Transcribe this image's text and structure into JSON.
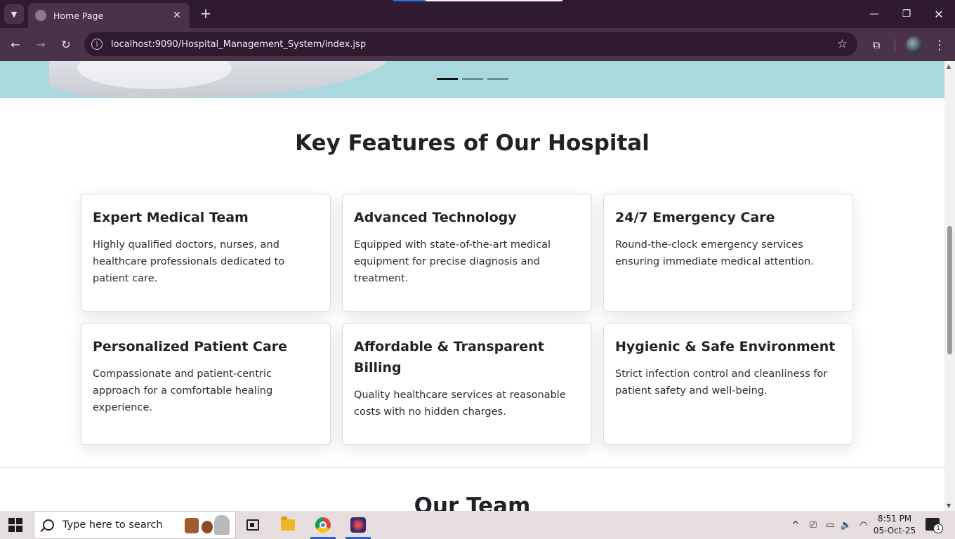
{
  "browser": {
    "tab_title": "Home Page",
    "url": "localhost:9090/Hospital_Management_System/index.jsp"
  },
  "page": {
    "features_title": "Key Features of Our Hospital",
    "features": [
      {
        "title": "Expert Medical Team",
        "text": "Highly qualified doctors, nurses, and healthcare professionals dedicated to patient care."
      },
      {
        "title": "Advanced Technology",
        "text": "Equipped with state-of-the-art medical equipment for precise diagnosis and treatment."
      },
      {
        "title": "24/7 Emergency Care",
        "text": "Round-the-clock emergency services ensuring immediate medical attention."
      },
      {
        "title": "Personalized Patient Care",
        "text": "Compassionate and patient-centric approach for a comfortable healing experience."
      },
      {
        "title": "Affordable & Transparent Billing",
        "text": "Quality healthcare services at reasonable costs with no hidden charges."
      },
      {
        "title": "Hygienic & Safe Environment",
        "text": "Strict infection control and cleanliness for patient safety and well-being."
      }
    ],
    "team_title": "Our Team",
    "carousel": {
      "slide_count": 3,
      "active_index": 0
    }
  },
  "taskbar": {
    "search_placeholder": "Type here to search",
    "time": "8:51 PM",
    "date": "05-Oct-25",
    "notification_count": "1"
  },
  "icons": {
    "tab_list": "chevron-down-icon",
    "tab_close": "close-icon",
    "new_tab": "plus-icon",
    "back": "arrow-left-icon",
    "forward": "arrow-right-icon",
    "reload": "reload-icon",
    "site_info": "info-icon",
    "bookmark": "star-icon",
    "extensions": "puzzle-icon",
    "menu": "kebab-menu-icon"
  },
  "colors": {
    "chrome_dark": "#2f1a2f",
    "chrome_toolbar": "#4a3249",
    "hero_bg": "#aad8df",
    "taskbar_bg": "#e6dede"
  }
}
